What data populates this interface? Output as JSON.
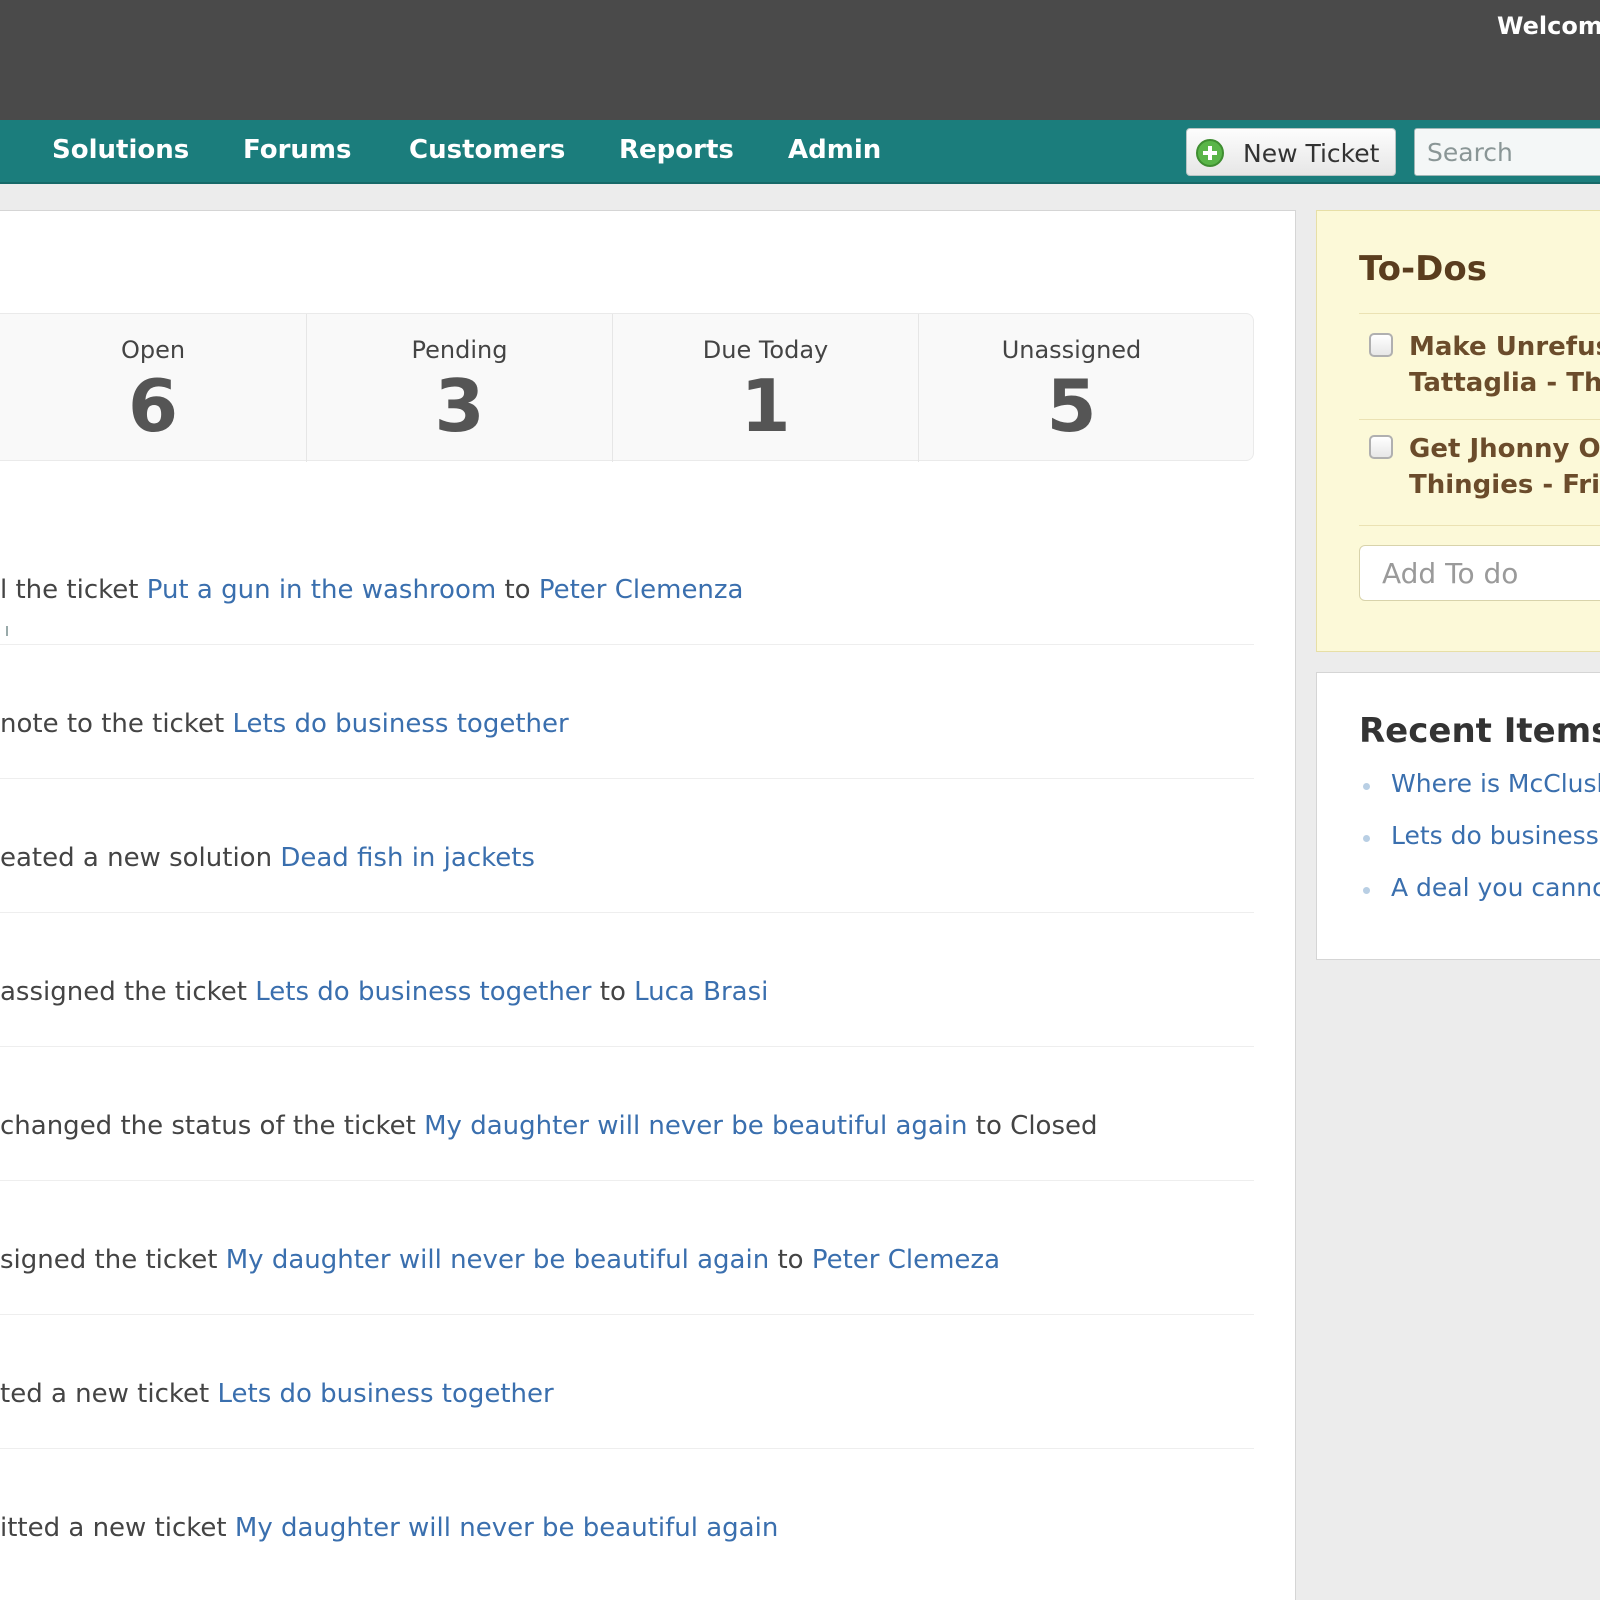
{
  "header": {
    "welcome": "Welcome"
  },
  "nav": {
    "items": [
      "Solutions",
      "Forums",
      "Customers",
      "Reports",
      "Admin"
    ],
    "new_ticket_label": "New Ticket",
    "search_placeholder": "Search"
  },
  "stats": [
    {
      "label": "Open",
      "value": "6"
    },
    {
      "label": "Pending",
      "value": "3"
    },
    {
      "label": "Due Today",
      "value": "1"
    },
    {
      "label": "Unassigned",
      "value": "5"
    }
  ],
  "activity": [
    {
      "prefix": "l the ticket ",
      "link1": "Put a gun in the washroom",
      "mid": " to ",
      "link2": "Peter Clemenza",
      "suffix": ""
    },
    {
      "prefix": "note to the ticket ",
      "link1": "Lets do business together",
      "mid": "",
      "link2": "",
      "suffix": ""
    },
    {
      "prefix": "eated a new solution ",
      "link1": "Dead fish in jackets",
      "mid": "",
      "link2": "",
      "suffix": ""
    },
    {
      "prefix": "assigned the ticket ",
      "link1": "Lets do business together",
      "mid": " to ",
      "link2": "Luca Brasi",
      "suffix": ""
    },
    {
      "prefix": " changed the status of the ticket ",
      "link1": "My daughter will never be beautiful again",
      "mid": " to Closed",
      "link2": "",
      "suffix": ""
    },
    {
      "prefix": "signed the ticket ",
      "link1": "My daughter will never be beautiful again",
      "mid": " to ",
      "link2": "Peter Clemeza",
      "suffix": ""
    },
    {
      "prefix": "ted a new ticket ",
      "link1": "Lets do business together",
      "mid": "",
      "link2": "",
      "suffix": ""
    },
    {
      "prefix": "itted a new ticket ",
      "link1": "My daughter will never be beautiful again",
      "mid": "",
      "link2": "",
      "suffix": ""
    }
  ],
  "todos": {
    "title": "To-Dos",
    "items": [
      {
        "line1": "Make Unrefusal",
        "line2": "Tattaglia - Thu"
      },
      {
        "line1": "Get Jhonny One",
        "line2": "Thingies - Frida"
      }
    ],
    "add_placeholder": "Add To do"
  },
  "recent": {
    "title": "Recent Items",
    "items": [
      "Where is McClusk",
      "Lets do business t",
      "A deal you cannot"
    ]
  }
}
